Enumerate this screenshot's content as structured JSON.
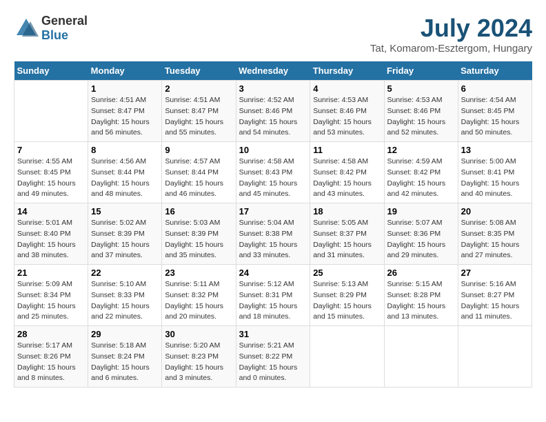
{
  "logo": {
    "general": "General",
    "blue": "Blue"
  },
  "title": "July 2024",
  "subtitle": "Tat, Komarom-Esztergom, Hungary",
  "days_header": [
    "Sunday",
    "Monday",
    "Tuesday",
    "Wednesday",
    "Thursday",
    "Friday",
    "Saturday"
  ],
  "weeks": [
    [
      {
        "num": "",
        "info": ""
      },
      {
        "num": "1",
        "info": "Sunrise: 4:51 AM\nSunset: 8:47 PM\nDaylight: 15 hours\nand 56 minutes."
      },
      {
        "num": "2",
        "info": "Sunrise: 4:51 AM\nSunset: 8:47 PM\nDaylight: 15 hours\nand 55 minutes."
      },
      {
        "num": "3",
        "info": "Sunrise: 4:52 AM\nSunset: 8:46 PM\nDaylight: 15 hours\nand 54 minutes."
      },
      {
        "num": "4",
        "info": "Sunrise: 4:53 AM\nSunset: 8:46 PM\nDaylight: 15 hours\nand 53 minutes."
      },
      {
        "num": "5",
        "info": "Sunrise: 4:53 AM\nSunset: 8:46 PM\nDaylight: 15 hours\nand 52 minutes."
      },
      {
        "num": "6",
        "info": "Sunrise: 4:54 AM\nSunset: 8:45 PM\nDaylight: 15 hours\nand 50 minutes."
      }
    ],
    [
      {
        "num": "7",
        "info": "Sunrise: 4:55 AM\nSunset: 8:45 PM\nDaylight: 15 hours\nand 49 minutes."
      },
      {
        "num": "8",
        "info": "Sunrise: 4:56 AM\nSunset: 8:44 PM\nDaylight: 15 hours\nand 48 minutes."
      },
      {
        "num": "9",
        "info": "Sunrise: 4:57 AM\nSunset: 8:44 PM\nDaylight: 15 hours\nand 46 minutes."
      },
      {
        "num": "10",
        "info": "Sunrise: 4:58 AM\nSunset: 8:43 PM\nDaylight: 15 hours\nand 45 minutes."
      },
      {
        "num": "11",
        "info": "Sunrise: 4:58 AM\nSunset: 8:42 PM\nDaylight: 15 hours\nand 43 minutes."
      },
      {
        "num": "12",
        "info": "Sunrise: 4:59 AM\nSunset: 8:42 PM\nDaylight: 15 hours\nand 42 minutes."
      },
      {
        "num": "13",
        "info": "Sunrise: 5:00 AM\nSunset: 8:41 PM\nDaylight: 15 hours\nand 40 minutes."
      }
    ],
    [
      {
        "num": "14",
        "info": "Sunrise: 5:01 AM\nSunset: 8:40 PM\nDaylight: 15 hours\nand 38 minutes."
      },
      {
        "num": "15",
        "info": "Sunrise: 5:02 AM\nSunset: 8:39 PM\nDaylight: 15 hours\nand 37 minutes."
      },
      {
        "num": "16",
        "info": "Sunrise: 5:03 AM\nSunset: 8:39 PM\nDaylight: 15 hours\nand 35 minutes."
      },
      {
        "num": "17",
        "info": "Sunrise: 5:04 AM\nSunset: 8:38 PM\nDaylight: 15 hours\nand 33 minutes."
      },
      {
        "num": "18",
        "info": "Sunrise: 5:05 AM\nSunset: 8:37 PM\nDaylight: 15 hours\nand 31 minutes."
      },
      {
        "num": "19",
        "info": "Sunrise: 5:07 AM\nSunset: 8:36 PM\nDaylight: 15 hours\nand 29 minutes."
      },
      {
        "num": "20",
        "info": "Sunrise: 5:08 AM\nSunset: 8:35 PM\nDaylight: 15 hours\nand 27 minutes."
      }
    ],
    [
      {
        "num": "21",
        "info": "Sunrise: 5:09 AM\nSunset: 8:34 PM\nDaylight: 15 hours\nand 25 minutes."
      },
      {
        "num": "22",
        "info": "Sunrise: 5:10 AM\nSunset: 8:33 PM\nDaylight: 15 hours\nand 22 minutes."
      },
      {
        "num": "23",
        "info": "Sunrise: 5:11 AM\nSunset: 8:32 PM\nDaylight: 15 hours\nand 20 minutes."
      },
      {
        "num": "24",
        "info": "Sunrise: 5:12 AM\nSunset: 8:31 PM\nDaylight: 15 hours\nand 18 minutes."
      },
      {
        "num": "25",
        "info": "Sunrise: 5:13 AM\nSunset: 8:29 PM\nDaylight: 15 hours\nand 15 minutes."
      },
      {
        "num": "26",
        "info": "Sunrise: 5:15 AM\nSunset: 8:28 PM\nDaylight: 15 hours\nand 13 minutes."
      },
      {
        "num": "27",
        "info": "Sunrise: 5:16 AM\nSunset: 8:27 PM\nDaylight: 15 hours\nand 11 minutes."
      }
    ],
    [
      {
        "num": "28",
        "info": "Sunrise: 5:17 AM\nSunset: 8:26 PM\nDaylight: 15 hours\nand 8 minutes."
      },
      {
        "num": "29",
        "info": "Sunrise: 5:18 AM\nSunset: 8:24 PM\nDaylight: 15 hours\nand 6 minutes."
      },
      {
        "num": "30",
        "info": "Sunrise: 5:20 AM\nSunset: 8:23 PM\nDaylight: 15 hours\nand 3 minutes."
      },
      {
        "num": "31",
        "info": "Sunrise: 5:21 AM\nSunset: 8:22 PM\nDaylight: 15 hours\nand 0 minutes."
      },
      {
        "num": "",
        "info": ""
      },
      {
        "num": "",
        "info": ""
      },
      {
        "num": "",
        "info": ""
      }
    ]
  ]
}
